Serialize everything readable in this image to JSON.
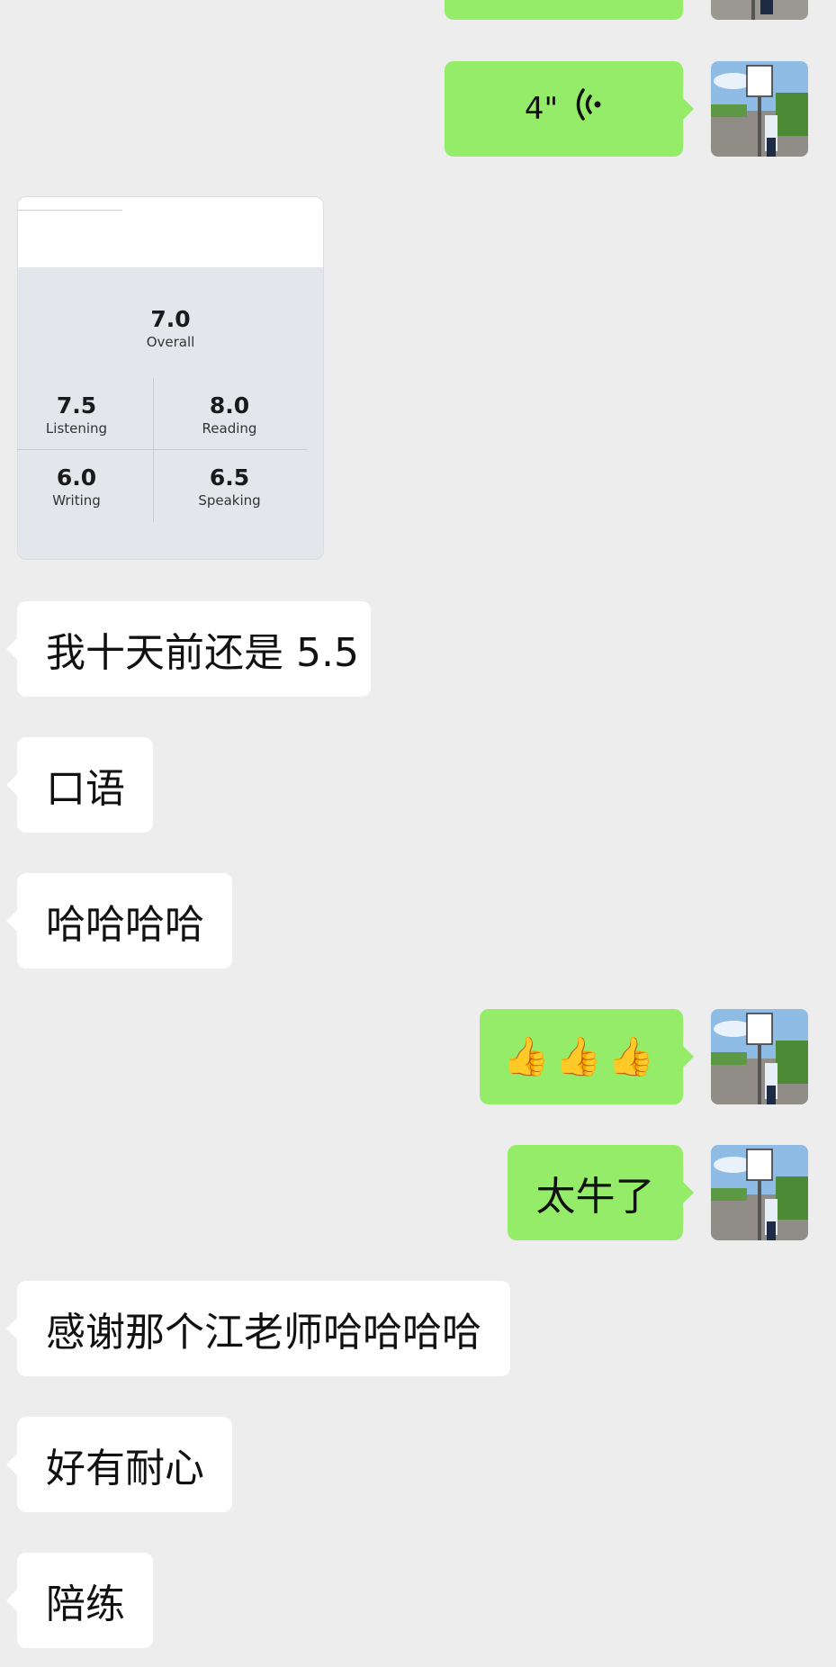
{
  "chat": {
    "voice_duration": "4\"",
    "score_card": {
      "overall": {
        "score": "7.0",
        "label": "Overall"
      },
      "listening": {
        "score": "7.5",
        "label": "Listening"
      },
      "reading": {
        "score": "8.0",
        "label": "Reading"
      },
      "writing": {
        "score": "6.0",
        "label": "Writing"
      },
      "speaking": {
        "score": "6.5",
        "label": "Speaking"
      }
    },
    "messages": {
      "m1": "我十天前还是 5.5",
      "m2": "口语",
      "m3": "哈哈哈哈",
      "m4": "👍👍👍",
      "m5": "太牛了",
      "m6": "感谢那个江老师哈哈哈哈",
      "m7": "好有耐心",
      "m8": "陪练"
    },
    "colors": {
      "background": "#ededed",
      "incoming_bubble": "#ffffff",
      "outgoing_bubble": "#95ec69"
    },
    "icons": {
      "voice": "voice-wave-icon",
      "avatar": "speed-limit-sign-photo"
    }
  }
}
